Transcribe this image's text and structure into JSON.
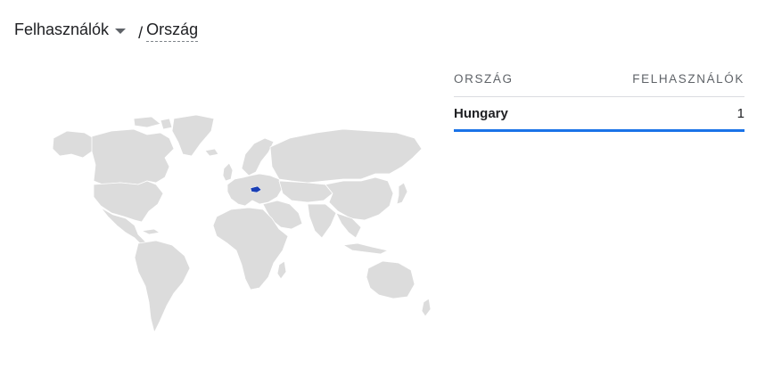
{
  "header": {
    "metric_label": "Felhasználók",
    "separator": "/",
    "dimension_label": "Ország"
  },
  "table": {
    "columns": [
      "ORSZÁG",
      "FELHASZNÁLÓK"
    ],
    "rows": [
      {
        "country": "Hungary",
        "users": "1"
      }
    ]
  },
  "map": {
    "land_color": "#dcdcdc",
    "border_color": "#ffffff",
    "highlight_color": "#1a3fb5",
    "highlighted_country": "Hungary"
  },
  "colors": {
    "accent": "#1a73e8"
  }
}
